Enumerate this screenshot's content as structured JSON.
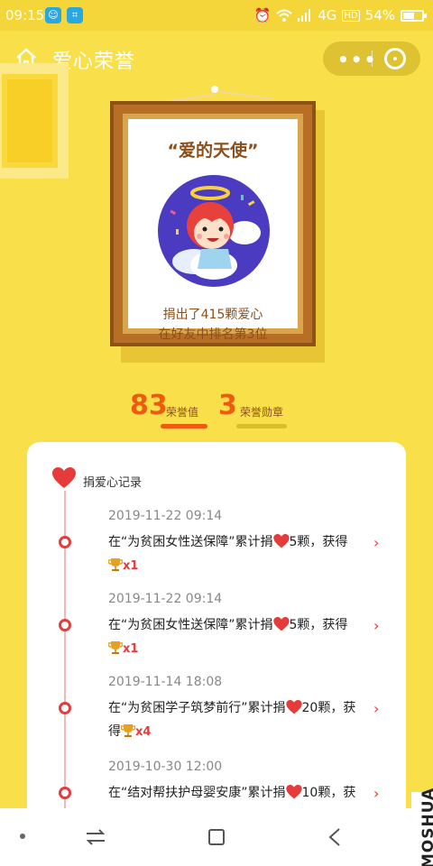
{
  "status": {
    "time": "09:15",
    "network": "4G",
    "hd": "HD",
    "battery": "54%"
  },
  "header": {
    "title": "爱心荣誉"
  },
  "frame": {
    "title": "“爱的天使”",
    "line1": "捐出了415颗爱心",
    "line2": "在好友中排名第3位"
  },
  "stats": {
    "honor_value": "83",
    "honor_value_label": "荣誉值",
    "medal_count": "3",
    "medal_label": "荣誉勋章"
  },
  "records": {
    "heading": "捐爱心记录",
    "items": [
      {
        "date": "2019-11-22 09:14",
        "prefix": "在“为贫困女性送保障”累计捐",
        "suffix": "5颗，获得",
        "mult": "x1"
      },
      {
        "date": "2019-11-22 09:14",
        "prefix": "在“为贫困女性送保障”累计捐",
        "suffix": "5颗，获得",
        "mult": "x1"
      },
      {
        "date": "2019-11-14 18:08",
        "prefix": "在“为贫困学子筑梦前行”累计捐",
        "suffix": "20颗，获得",
        "mult": "x4"
      },
      {
        "date": "2019-10-30 12:00",
        "prefix": "在“结对帮扶护母婴安康”累计捐",
        "suffix": "10颗，获",
        "mult": ""
      }
    ]
  },
  "watermark": "MOSHUA",
  "colors": {
    "background": "#f9e04a",
    "accent": "#f05a10",
    "heart": "#e63b3b",
    "frame": "#b66f24"
  }
}
